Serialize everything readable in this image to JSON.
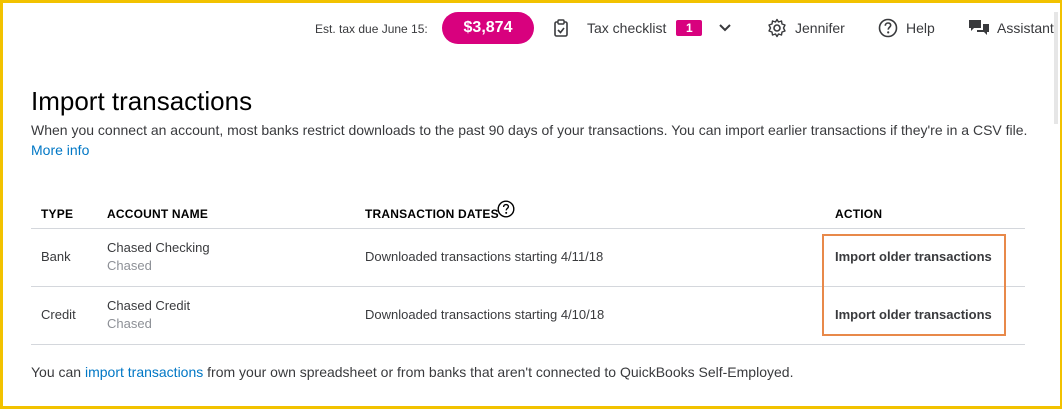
{
  "topbar": {
    "tax_label": "Est. tax due June 15:",
    "tax_amount": "$3,874",
    "tax_checklist_label": "Tax checklist",
    "tax_checklist_count": "1",
    "user_label": "Jennifer",
    "help_label": "Help",
    "assistant_label": "Assistant"
  },
  "page": {
    "title": "Import transactions",
    "intro_text": "When you connect an account, most banks restrict downloads to the past 90 days of your transactions. You can import earlier transactions if they're in a CSV file.",
    "more_info_link": "More info"
  },
  "table": {
    "headers": {
      "type": "TYPE",
      "account_name": "ACCOUNT NAME",
      "transaction_dates": "TRANSACTION DATES",
      "action": "ACTION"
    },
    "rows": [
      {
        "type": "Bank",
        "account_name": "Chased Checking",
        "institution": "Chased",
        "dates": "Downloaded transactions starting 4/11/18",
        "action": "Import older transactions"
      },
      {
        "type": "Credit",
        "account_name": "Chased Credit",
        "institution": "Chased",
        "dates": "Downloaded transactions starting 4/10/18",
        "action": "Import older transactions"
      }
    ]
  },
  "footer": {
    "prefix": "You can",
    "link": "import transactions",
    "suffix": "from your own spreadsheet or from banks that aren't connected to QuickBooks Self-Employed."
  },
  "colors": {
    "accent_pink": "#d8017e",
    "link_blue": "#0077c5",
    "highlight_orange": "#e8894a",
    "frame_yellow": "#f2c200"
  }
}
